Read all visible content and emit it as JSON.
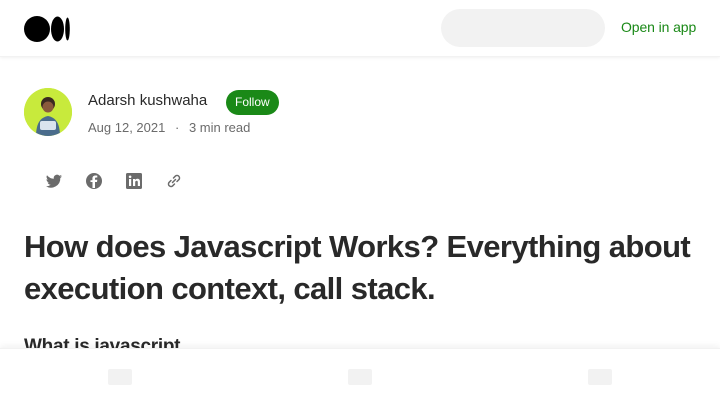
{
  "header": {
    "logo_icon": "medium-logo-icon",
    "search_placeholder": "",
    "open_in_app_label": "Open in app",
    "accent_color": "#1a8917"
  },
  "author": {
    "name": "Adarsh kushwaha",
    "follow_label": "Follow",
    "avatar_icon": "author-avatar",
    "date": "Aug 12, 2021",
    "separator": "·",
    "read_time": "3 min read"
  },
  "share": {
    "icons": [
      "twitter-icon",
      "facebook-icon",
      "linkedin-icon",
      "link-icon"
    ]
  },
  "article": {
    "title": "How does Javascript Works? Everything about execution context, call stack.",
    "subheading": "What is javascript"
  },
  "bottom_bar": {
    "icons": [
      "placeholder-icon",
      "placeholder-icon",
      "placeholder-icon"
    ]
  }
}
